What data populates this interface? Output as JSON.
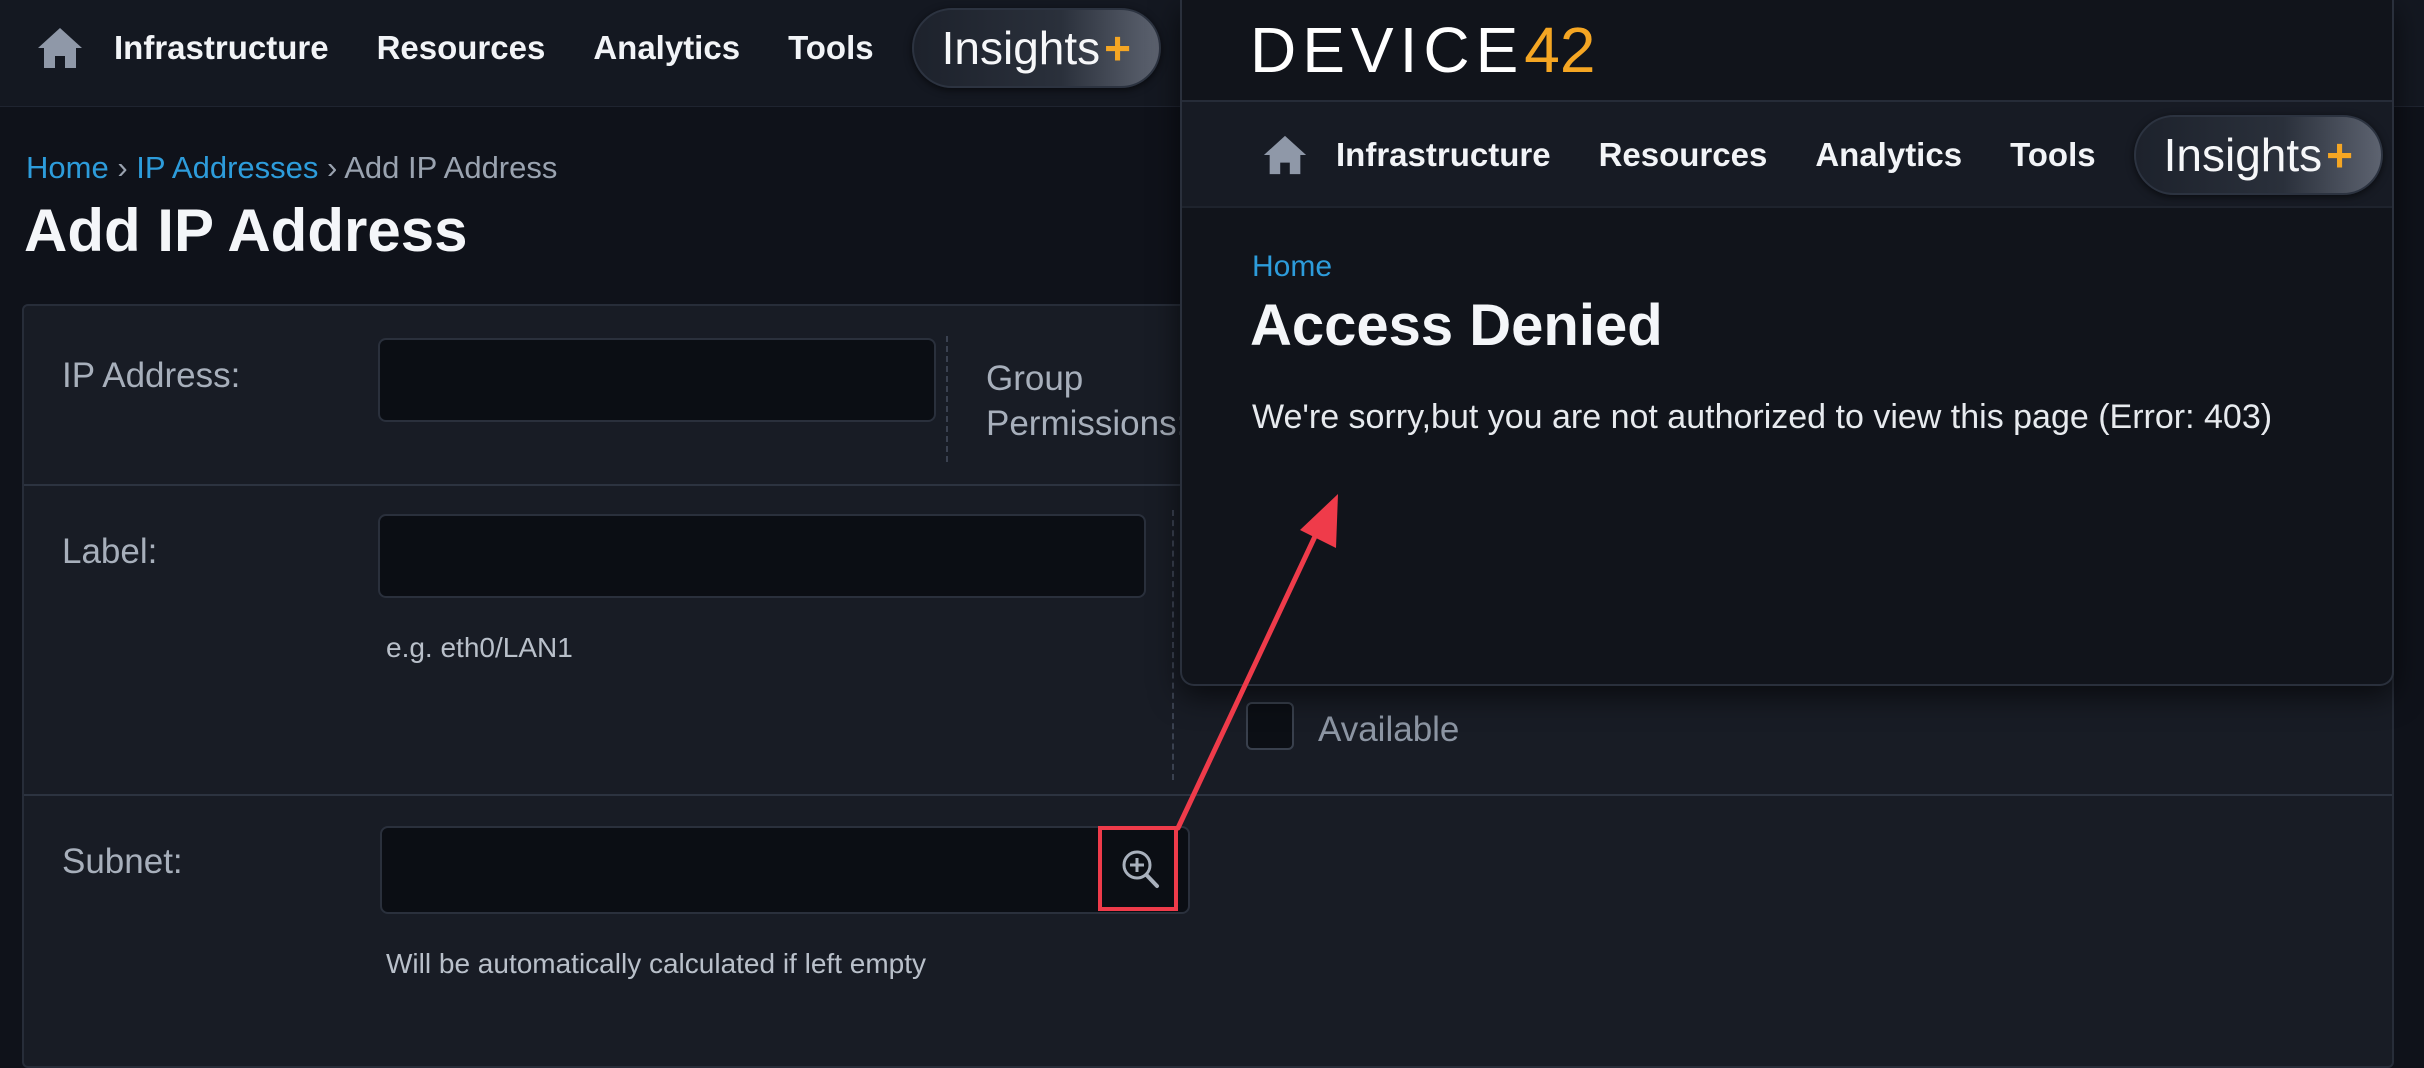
{
  "nav": {
    "items": [
      "Infrastructure",
      "Resources",
      "Analytics",
      "Tools"
    ],
    "insights_label": "Insights",
    "insights_plus": "+"
  },
  "breadcrumb": {
    "home": "Home",
    "ip_addresses": "IP Addresses",
    "current": "Add IP Address",
    "separator": "›"
  },
  "page_title": "Add IP Address",
  "form": {
    "ip_address_label": "IP Address:",
    "group_permissions_label_line1": "Group",
    "group_permissions_label_line2": "Permissions:",
    "label_label": "Label:",
    "label_hint": "e.g. eth0/LAN1",
    "available_label": "Available",
    "subnet_label": "Subnet:",
    "subnet_hint": "Will be automatically calculated if left empty"
  },
  "overlay": {
    "logo_text": "DEVICE",
    "logo_number": "42",
    "nav_items": [
      "Infrastructure",
      "Resources",
      "Analytics",
      "Tools"
    ],
    "insights_label": "Insights",
    "insights_plus": "+",
    "breadcrumb_home": "Home",
    "title": "Access Denied",
    "message": "We're sorry,but you are not authorized to view this page (Error: 403)"
  },
  "colors": {
    "accent_link": "#2d9cdb",
    "brand_orange": "#f5a623",
    "annotation_red": "#ef3b4a"
  }
}
